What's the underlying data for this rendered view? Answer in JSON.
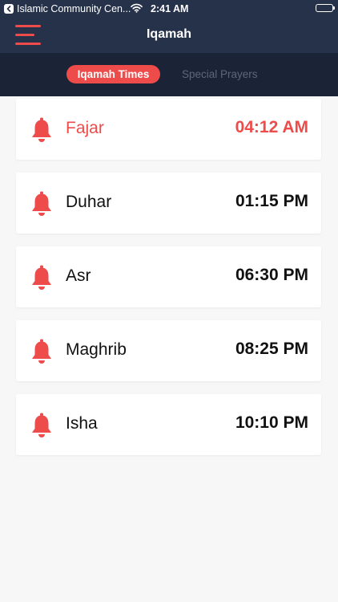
{
  "status_bar": {
    "back_app_name": "Islamic Community Cen...",
    "time": "2:41 AM",
    "icons": [
      "back-chevron-icon",
      "wifi-icon",
      "battery-icon"
    ]
  },
  "nav": {
    "title": "Iqamah",
    "menu_icon": "hamburger-menu-icon"
  },
  "tabs": [
    {
      "label": "Iqamah Times",
      "active": true
    },
    {
      "label": "Special Prayers",
      "active": false
    }
  ],
  "prayers": [
    {
      "name": "Fajar",
      "time": "04:12 AM",
      "highlighted": true
    },
    {
      "name": "Duhar",
      "time": "01:15 PM",
      "highlighted": false
    },
    {
      "name": "Asr",
      "time": "06:30 PM",
      "highlighted": false
    },
    {
      "name": "Maghrib",
      "time": "08:25 PM",
      "highlighted": false
    },
    {
      "name": "Isha",
      "time": "10:10 PM",
      "highlighted": false
    }
  ],
  "colors": {
    "accent": "#ee4b4b",
    "header": "#26324a",
    "segment_bar": "#1b2337",
    "background": "#f7f7f7"
  }
}
